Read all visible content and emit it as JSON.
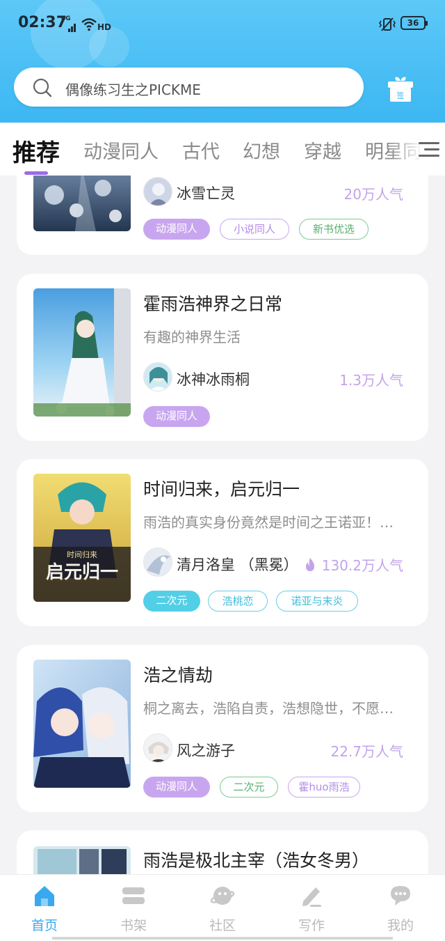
{
  "status_bar": {
    "time": "02:37",
    "network": "4G",
    "hd": "HD",
    "battery": "36"
  },
  "search": {
    "placeholder": "偶像练习生之PICKME"
  },
  "header": {
    "gift_label": "签"
  },
  "tabs": [
    {
      "label": "推荐",
      "active": true
    },
    {
      "label": "动漫同人"
    },
    {
      "label": "古代"
    },
    {
      "label": "幻想"
    },
    {
      "label": "穿越"
    },
    {
      "label": "明星同"
    }
  ],
  "books": [
    {
      "title": "",
      "desc": "",
      "author": "冰雪亡灵",
      "popularity": "20万人气",
      "hot": false,
      "tags": [
        {
          "label": "动漫同人",
          "style": "fill-purple"
        },
        {
          "label": "小说同人",
          "style": "out-purple"
        },
        {
          "label": "新书优选",
          "style": "out-green"
        }
      ]
    },
    {
      "title": "霍雨浩神界之日常",
      "desc": "有趣的神界生活",
      "author": "冰神冰雨桐",
      "popularity": "1.3万人气",
      "hot": false,
      "tags": [
        {
          "label": "动漫同人",
          "style": "fill-purple"
        }
      ]
    },
    {
      "title": "时间归来，启元归一",
      "desc": "雨浩的真实身份竟然是时间之王诺亚！…",
      "author": "清月洛皇 （黑冕）",
      "popularity": "130.2万人气",
      "hot": true,
      "cover_text": "启元归一",
      "cover_subtext": "时间归来",
      "tags": [
        {
          "label": "二次元",
          "style": "fill-cyan"
        },
        {
          "label": "浩桃恋",
          "style": "out-cyan"
        },
        {
          "label": "诺亚与末炎",
          "style": "out-cyan"
        }
      ]
    },
    {
      "title": "浩之情劫",
      "desc": "桐之离去，浩陷自责，浩想隐世，不愿…",
      "author": "风之游子",
      "popularity": "22.7万人气",
      "hot": false,
      "tags": [
        {
          "label": "动漫同人",
          "style": "fill-purple"
        },
        {
          "label": "二次元",
          "style": "out-green"
        },
        {
          "label": "霍huo雨浩",
          "style": "out-purple"
        }
      ]
    },
    {
      "title": "雨浩是极北主宰（浩女冬男）",
      "desc": "",
      "author": "",
      "popularity": "",
      "hot": false,
      "tags": []
    }
  ],
  "bottom_nav": [
    {
      "label": "首页",
      "icon": "home-icon",
      "active": true
    },
    {
      "label": "书架",
      "icon": "bookshelf-icon"
    },
    {
      "label": "社区",
      "icon": "community-planet-icon"
    },
    {
      "label": "写作",
      "icon": "pen-icon"
    },
    {
      "label": "我的",
      "icon": "profile-chat-icon"
    }
  ],
  "colors": {
    "header": "#3db7f2",
    "accent_purple": "#9b6be6",
    "tag_purple": "#c8a6ef",
    "tag_cyan": "#52cfe6",
    "tag_green": "#7ccb8e",
    "nav_active": "#39a9ef"
  }
}
